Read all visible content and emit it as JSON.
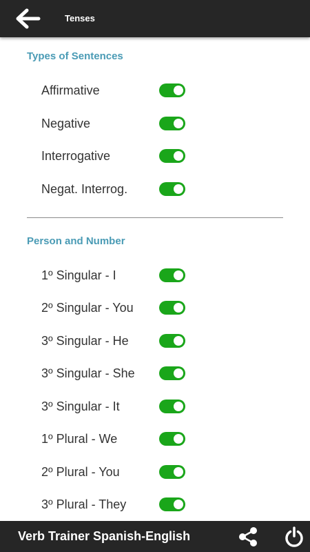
{
  "header": {
    "title": "Tenses",
    "back_icon": "arrow-left-icon"
  },
  "accent_colors": {
    "toolbar": "#262626",
    "section_header": "#4a9bb5",
    "toggle_on": "#1aa61a"
  },
  "sentence_types": {
    "header": "Types of Sentences",
    "items": [
      {
        "label": "Affirmative",
        "enabled": true
      },
      {
        "label": "Negative",
        "enabled": true
      },
      {
        "label": "Interrogative",
        "enabled": true
      },
      {
        "label": "Negat. Interrog.",
        "enabled": true
      }
    ]
  },
  "person_number": {
    "header": "Person and Number",
    "items": [
      {
        "label": "1º Singular - I",
        "enabled": true
      },
      {
        "label": "2º Singular - You",
        "enabled": true
      },
      {
        "label": "3º Singular - He",
        "enabled": true
      },
      {
        "label": "3º Singular - She",
        "enabled": true
      },
      {
        "label": "3º Singular - It",
        "enabled": true
      },
      {
        "label": "1º Plural - We",
        "enabled": true
      },
      {
        "label": "2º Plural - You",
        "enabled": true
      },
      {
        "label": "3º Plural - They",
        "enabled": true
      }
    ]
  },
  "footer": {
    "app_name": "Verb Trainer Spanish-English",
    "share_icon": "share-icon",
    "power_icon": "power-icon"
  }
}
